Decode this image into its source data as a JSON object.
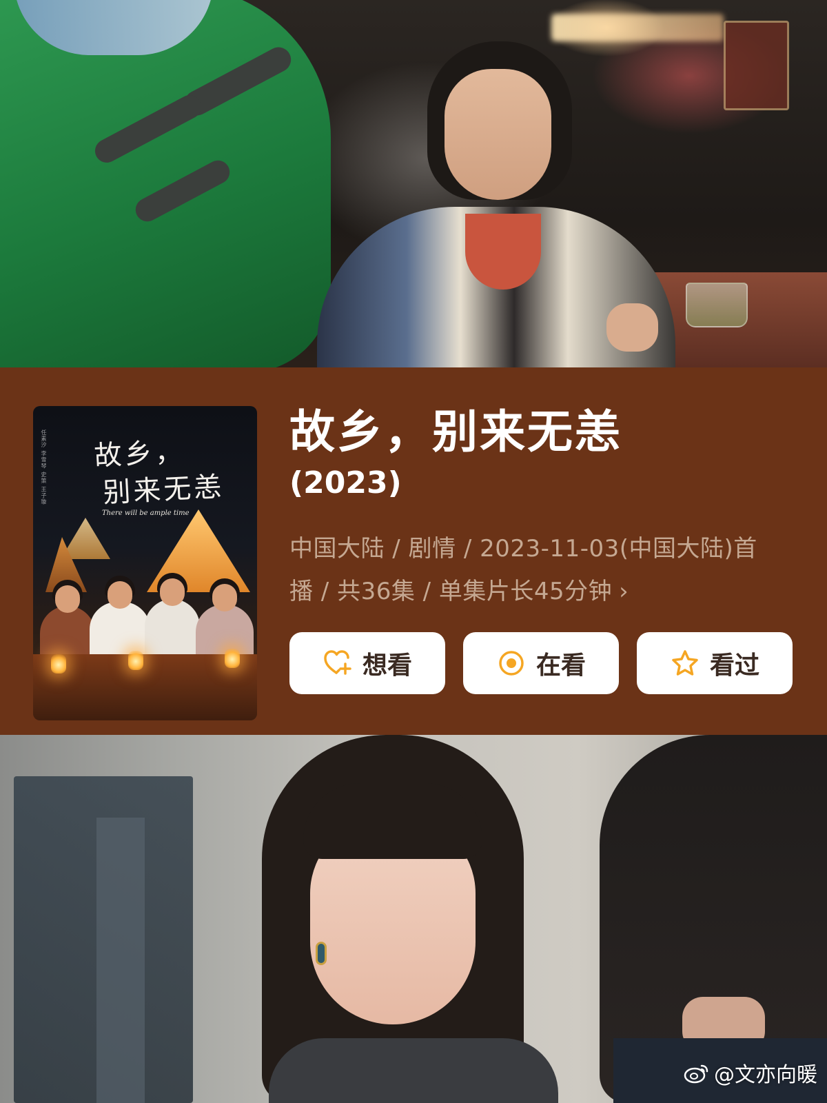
{
  "film": {
    "title": "故乡，别来无恙",
    "year": "(2023)",
    "meta_line1": "中国大陆 / 剧情 / 2023-11-03(中国大陆)首",
    "meta_line2": "播 / 共36集 / 单集片长45分钟",
    "meta_chevron": "›"
  },
  "poster": {
    "title_line1": "故乡，",
    "title_line2": "别来无恙",
    "subtitle": "There will be ample time",
    "credits": "任素汐 李雪琴 史策 王子璇"
  },
  "actions": [
    {
      "label": "想看",
      "icon": "heart-plus-icon"
    },
    {
      "label": "在看",
      "icon": "target-circle-icon"
    },
    {
      "label": "看过",
      "icon": "star-icon"
    }
  ],
  "watermark": {
    "handle": "@文亦向暖",
    "icon": "weibo-icon"
  },
  "colors": {
    "band": "#6b3317",
    "accent": "#f5a623",
    "meta_text": "#c5a892",
    "button_bg": "#ffffff"
  }
}
